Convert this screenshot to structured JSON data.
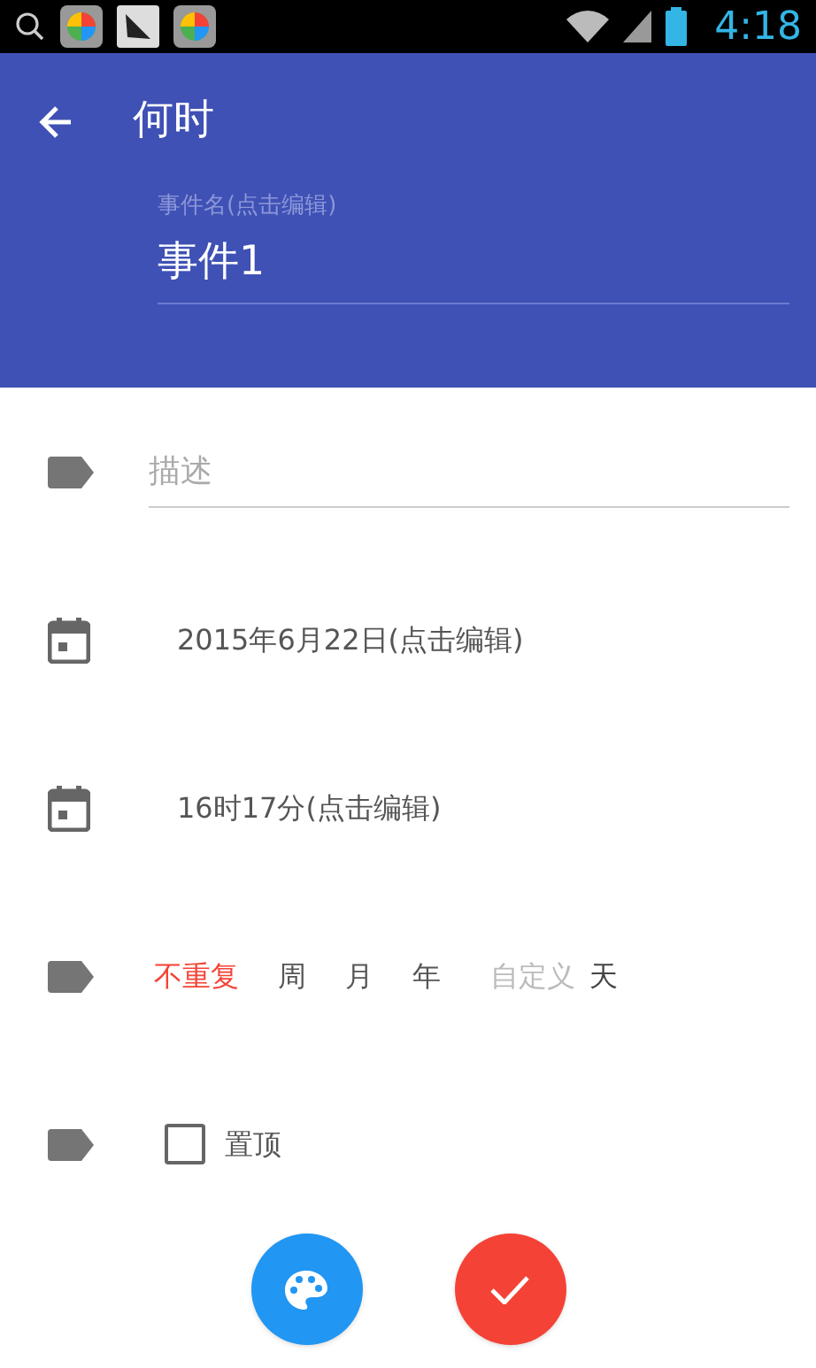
{
  "status_bar": {
    "time": "4:18"
  },
  "toolbar": {
    "title": "何时"
  },
  "event_name": {
    "label": "事件名(点击编辑)",
    "value": "事件1"
  },
  "description": {
    "placeholder": "描述"
  },
  "date": {
    "text": "2015年6月22日(点击编辑)"
  },
  "time": {
    "text": "16时17分(点击编辑)"
  },
  "repeat": {
    "options": [
      {
        "label": "不重复",
        "selected": true
      },
      {
        "label": "周",
        "selected": false
      },
      {
        "label": "月",
        "selected": false
      },
      {
        "label": "年",
        "selected": false
      }
    ],
    "custom": {
      "placeholder": "自定义"
    },
    "unit": "天"
  },
  "pin": {
    "label": "置顶",
    "checked": false
  }
}
